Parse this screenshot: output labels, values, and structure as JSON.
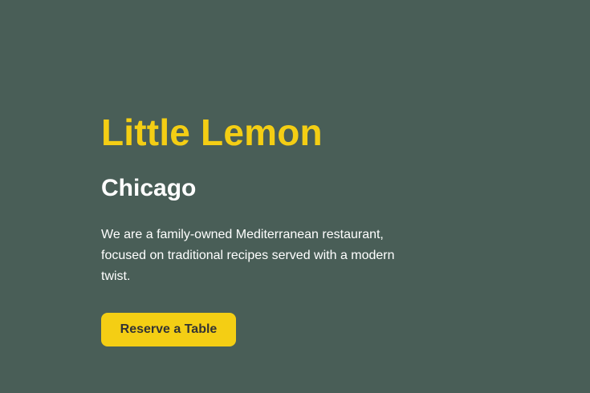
{
  "hero": {
    "title": "Little Lemon",
    "subtitle": "Chicago",
    "description": "We are a family-owned Mediterranean restaurant, focused on traditional recipes served with a modern twist.",
    "cta_label": "Reserve a Table"
  },
  "colors": {
    "background": "#495e57",
    "accent": "#f4ce14",
    "text_light": "#ffffff",
    "button_text": "#333333"
  }
}
